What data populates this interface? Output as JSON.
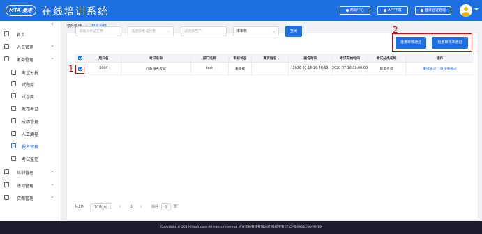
{
  "header": {
    "logo_text": "MTA 麦塔",
    "app_title": "在线培训系统",
    "buttons": [
      {
        "label": "帮助中心",
        "icon": "help-icon"
      },
      {
        "label": "APP下载",
        "icon": "download-icon"
      },
      {
        "label": "登录验证管理",
        "icon": "user-icon"
      }
    ],
    "avatar_icon": "avatar-icon"
  },
  "sidebar": {
    "items": [
      {
        "label": "首页",
        "icon": "home-icon",
        "has_arrow": false
      },
      {
        "label": "人员管理",
        "icon": "user-icon",
        "has_arrow": true
      },
      {
        "label": "考务管理",
        "icon": "exam-icon",
        "has_arrow": true
      },
      {
        "label": "考试分析",
        "icon": "analysis-icon",
        "sub": true
      },
      {
        "label": "试题库",
        "icon": "question-bank-icon",
        "sub": true
      },
      {
        "label": "试卷库",
        "icon": "paper-icon",
        "sub": true
      },
      {
        "label": "发布考试",
        "icon": "publish-icon",
        "sub": true
      },
      {
        "label": "成绩管理",
        "icon": "score-icon",
        "sub": true
      },
      {
        "label": "人工阅卷",
        "icon": "grading-icon",
        "sub": true
      },
      {
        "label": "报名审核",
        "icon": "audit-icon",
        "sub": true,
        "active": true
      },
      {
        "label": "考试监控",
        "icon": "monitor-icon",
        "sub": true
      },
      {
        "label": "培训管理",
        "icon": "training-icon",
        "has_arrow": true
      },
      {
        "label": "练习管理",
        "icon": "practice-icon",
        "has_arrow": true
      },
      {
        "label": "资源管理",
        "icon": "resource-icon",
        "has_arrow": true
      }
    ],
    "collapse_glyph": "‹"
  },
  "breadcrumb": {
    "parent": "考务管理",
    "separator": ">",
    "current": "报名审核"
  },
  "filters": {
    "exam_name_placeholder": "请输入考试名称",
    "category_placeholder": "请选择考试分类",
    "user_placeholder": "请选择用户",
    "status_value": "未审核",
    "query_label": "查询"
  },
  "batch": {
    "approve_label": "批量审核通过",
    "reject_label": "批量审核未通过"
  },
  "annotations": {
    "one": "1",
    "two": "2"
  },
  "table": {
    "columns": [
      "用户名",
      "考试名称",
      "部门名称",
      "审核状态",
      "真实姓名",
      "报名时间",
      "考试开始时间",
      "考试分类名称",
      "操作"
    ],
    "rows": [
      {
        "checked": true,
        "username": "0004",
        "exam_name": "行政报名考试",
        "department": "test",
        "status": "未审核",
        "real_name": "",
        "signup_time": "2020-07-15 15:48:59",
        "start_time": "2020-07-16 00:00:00",
        "category": "日常考试",
        "action_approve": "审核通过",
        "action_sep": "|",
        "action_reject": "审核未通过"
      }
    ]
  },
  "pager": {
    "total": "共1条",
    "page_size": "10条/页",
    "prev": "‹",
    "current_page": "1",
    "next": "›",
    "goto_label": "前往",
    "goto_value": "1",
    "page_suffix": "页"
  },
  "footer": {
    "text": "Copyright © 2019 lllsoft.com All rights reserved 大连麦格科技有限公司 版权所有 辽ICP备09022984号-19"
  },
  "colors": {
    "primary": "#1e6fe0",
    "annotation": "#e60000",
    "footer_bg": "#1f1a2e"
  }
}
